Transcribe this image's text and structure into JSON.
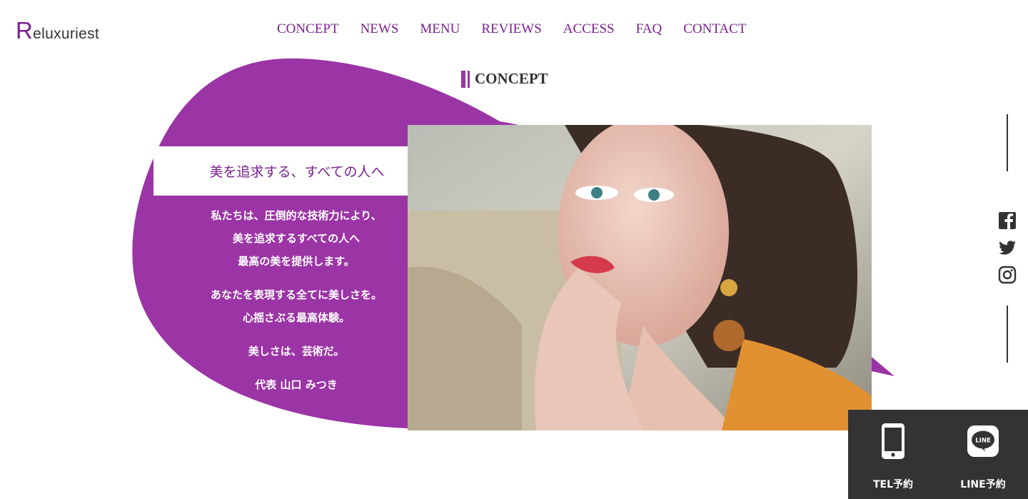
{
  "brand": {
    "initial": "R",
    "rest": "eluxuriest"
  },
  "nav": [
    "CONCEPT",
    "NEWS",
    "MENU",
    "REVIEWS",
    "ACCESS",
    "FAQ",
    "CONTACT"
  ],
  "section": {
    "title": "CONCEPT"
  },
  "concept": {
    "headline": "美を追求する、すべての人へ",
    "paragraphs": [
      [
        "私たちは、圧倒的な技術力により、",
        "美を追求するすべての人へ",
        "最高の美を提供します。"
      ],
      [
        "あなたを表現する全てに美しさを。",
        "心揺さぶる最高体験。"
      ],
      [
        "美しさは、芸術だ。"
      ],
      [
        "代表 山口 みつき"
      ]
    ]
  },
  "social": [
    "facebook-icon",
    "twitter-icon",
    "instagram-icon"
  ],
  "reserve": {
    "tel_label": "TEL予約",
    "line_label": "LINE予約",
    "line_badge": "LINE"
  },
  "colors": {
    "accent": "#9b34a5",
    "brand_text": "#7b1f8f",
    "reserve_bg": "#333333"
  }
}
